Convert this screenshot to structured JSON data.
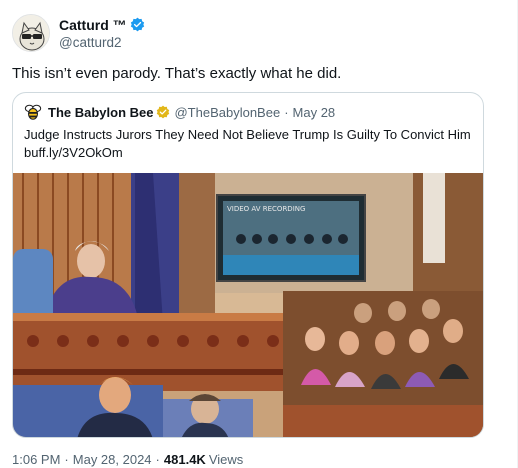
{
  "tweet": {
    "display_name": "Catturd ™",
    "handle": "@catturd2",
    "text": "This isn’t even parody. That’s exactly what he did.",
    "time": "1:06 PM",
    "date": "May 28, 2024",
    "views_count": "481.4K",
    "views_label": "Views"
  },
  "quote": {
    "display_name": "The Babylon Bee",
    "handle": "@TheBabylonBee",
    "separator": "·",
    "date": "May 28",
    "text_line1": "Judge Instructs Jurors They Need Not Believe Trump Is Guilty To Convict Him",
    "text_line2": "buff.ly/3V2OkOm",
    "image_sign": "VIDEO AV RECORDING"
  },
  "colors": {
    "verified_blue": "#1d9bf0",
    "verified_gold": "#e2b719",
    "secondary_text": "#536471",
    "border": "#cfd9de"
  },
  "icons": {
    "verified": "verified-badge-icon",
    "bee": "babylon-bee-logo-icon"
  }
}
